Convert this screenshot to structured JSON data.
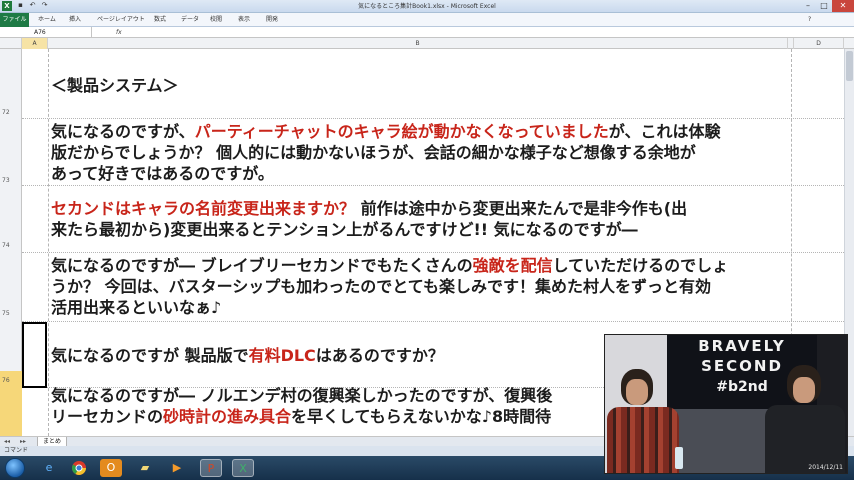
{
  "window": {
    "title": "気になるところ集計Book1.xlsx - Microsoft Excel",
    "app_icon": "excel-icon"
  },
  "ribbon": {
    "file_tab": "ファイル",
    "tabs": [
      "ホーム",
      "挿入",
      "ページレイアウト",
      "数式",
      "データ",
      "校閲",
      "表示",
      "開発"
    ]
  },
  "formula_bar": {
    "name_box": "A76",
    "fx_label": "fx",
    "content": ""
  },
  "columns": [
    "A",
    "B",
    "C",
    "D"
  ],
  "rows": [
    {
      "num": "72",
      "segments": [
        {
          "text": "＜製品システム＞",
          "red": false
        }
      ]
    },
    {
      "num": "73",
      "lines": [
        [
          {
            "text": "気になるのですが、",
            "red": false
          },
          {
            "text": "パーティーチャットのキャラ絵が動かなくなっていました",
            "red": true
          },
          {
            "text": "が、これは体験",
            "red": false
          }
        ],
        [
          {
            "text": "版だからでしょうか？ 個人的には動かないほうが、会話の細かな様子など想像する余地が",
            "red": false
          }
        ],
        [
          {
            "text": "あって好きではあるのですが。",
            "red": false
          }
        ]
      ]
    },
    {
      "num": "74",
      "lines": [
        [
          {
            "text": "セカンドはキャラの名前変更出来ますか？",
            "red": true
          },
          {
            "text": " 前作は途中から変更出来たんで是非今作も(出",
            "red": false
          }
        ],
        [
          {
            "text": "来たら最初から)変更出来るとテンション上がるんですけど!! 気になるのですが―",
            "red": false
          }
        ]
      ]
    },
    {
      "num": "75",
      "lines": [
        [
          {
            "text": "気になるのですが― ブレイブリーセカンドでもたくさんの",
            "red": false
          },
          {
            "text": "強敵を配信",
            "red": true
          },
          {
            "text": "していただけるのでしょ",
            "red": false
          }
        ],
        [
          {
            "text": "うか？ 今回は、バスターシップも加わったのでとても楽しみです！集めた村人をずっと有効",
            "red": false
          }
        ],
        [
          {
            "text": "活用出来るといいなぁ♪",
            "red": false
          }
        ]
      ]
    },
    {
      "num": "76",
      "lines": [
        [
          {
            "text": "気になるのですが 製品版で",
            "red": false
          },
          {
            "text": "有料DLC",
            "red": true
          },
          {
            "text": "はあるのですか？",
            "red": false
          }
        ]
      ]
    },
    {
      "num": "",
      "lines": [
        [
          {
            "text": "気になるのですが― ノルエンデ村の復興楽しかったのですが、復興後",
            "red": false
          }
        ],
        [
          {
            "text": "リーセカンドの",
            "red": false
          },
          {
            "text": "砂時計の進み具合",
            "red": true
          },
          {
            "text": "を早くしてもらえないかな♪8時間待",
            "red": false
          }
        ]
      ]
    }
  ],
  "sheet_tab": "まとめ",
  "status_bar": "コマンド",
  "taskbar": {
    "icons": [
      "windows-start-icon",
      "internet-explorer-icon",
      "chrome-icon",
      "outlook-icon",
      "folder-icon",
      "media-player-icon",
      "powerpoint-icon",
      "excel-icon"
    ]
  },
  "video_overlay": {
    "banner_line1": "BRAVELY",
    "banner_line2": "SECOND",
    "banner_line3": "#b2nd",
    "date": "2014/12/11"
  },
  "colors": {
    "red_highlight": "#c8251a",
    "excel_green": "#1e7a45",
    "row_selected": "#f6d779"
  }
}
